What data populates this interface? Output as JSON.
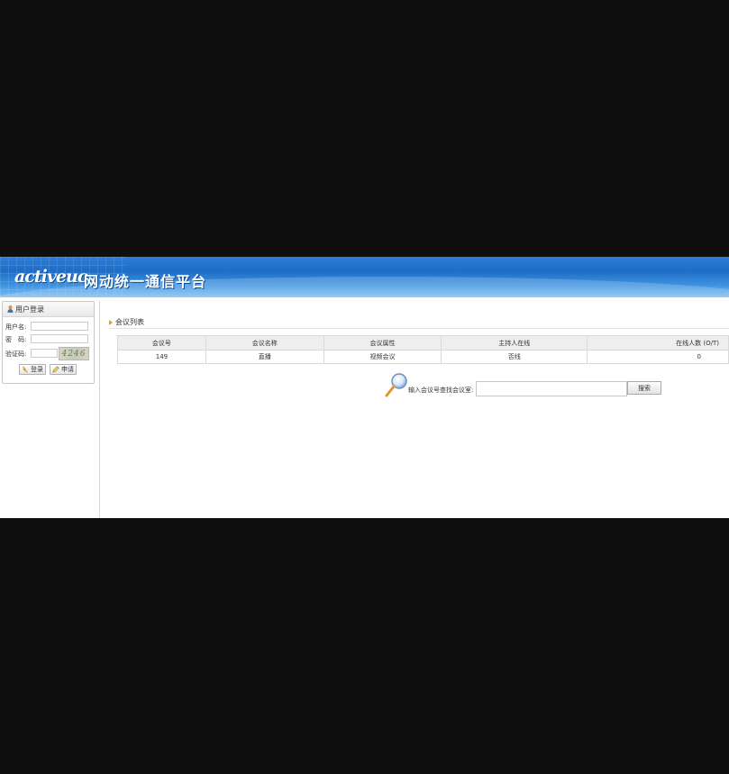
{
  "header": {
    "logo_main": "activeuc",
    "title": "网动统一通信平台"
  },
  "login": {
    "title": "用户登录",
    "username_label": "用户名:",
    "password_label": "密　码:",
    "captcha_label": "验证码:",
    "captcha_text": "4246",
    "login_button": "登录",
    "register_button": "申请"
  },
  "meetings": {
    "section_title": "会议列表",
    "columns": [
      "会议号",
      "会议名称",
      "会议属性",
      "主持人在线",
      "在线人数 (O/T)"
    ],
    "rows": [
      [
        "149",
        "直播",
        "视频会议",
        "否线",
        "0"
      ]
    ]
  },
  "search": {
    "label": "输入会议号查找会议室:",
    "input_value": "",
    "button": "搜索"
  },
  "colors": {
    "header_blue": "#1e6cc6",
    "accent_orange": "#f09a1a"
  }
}
